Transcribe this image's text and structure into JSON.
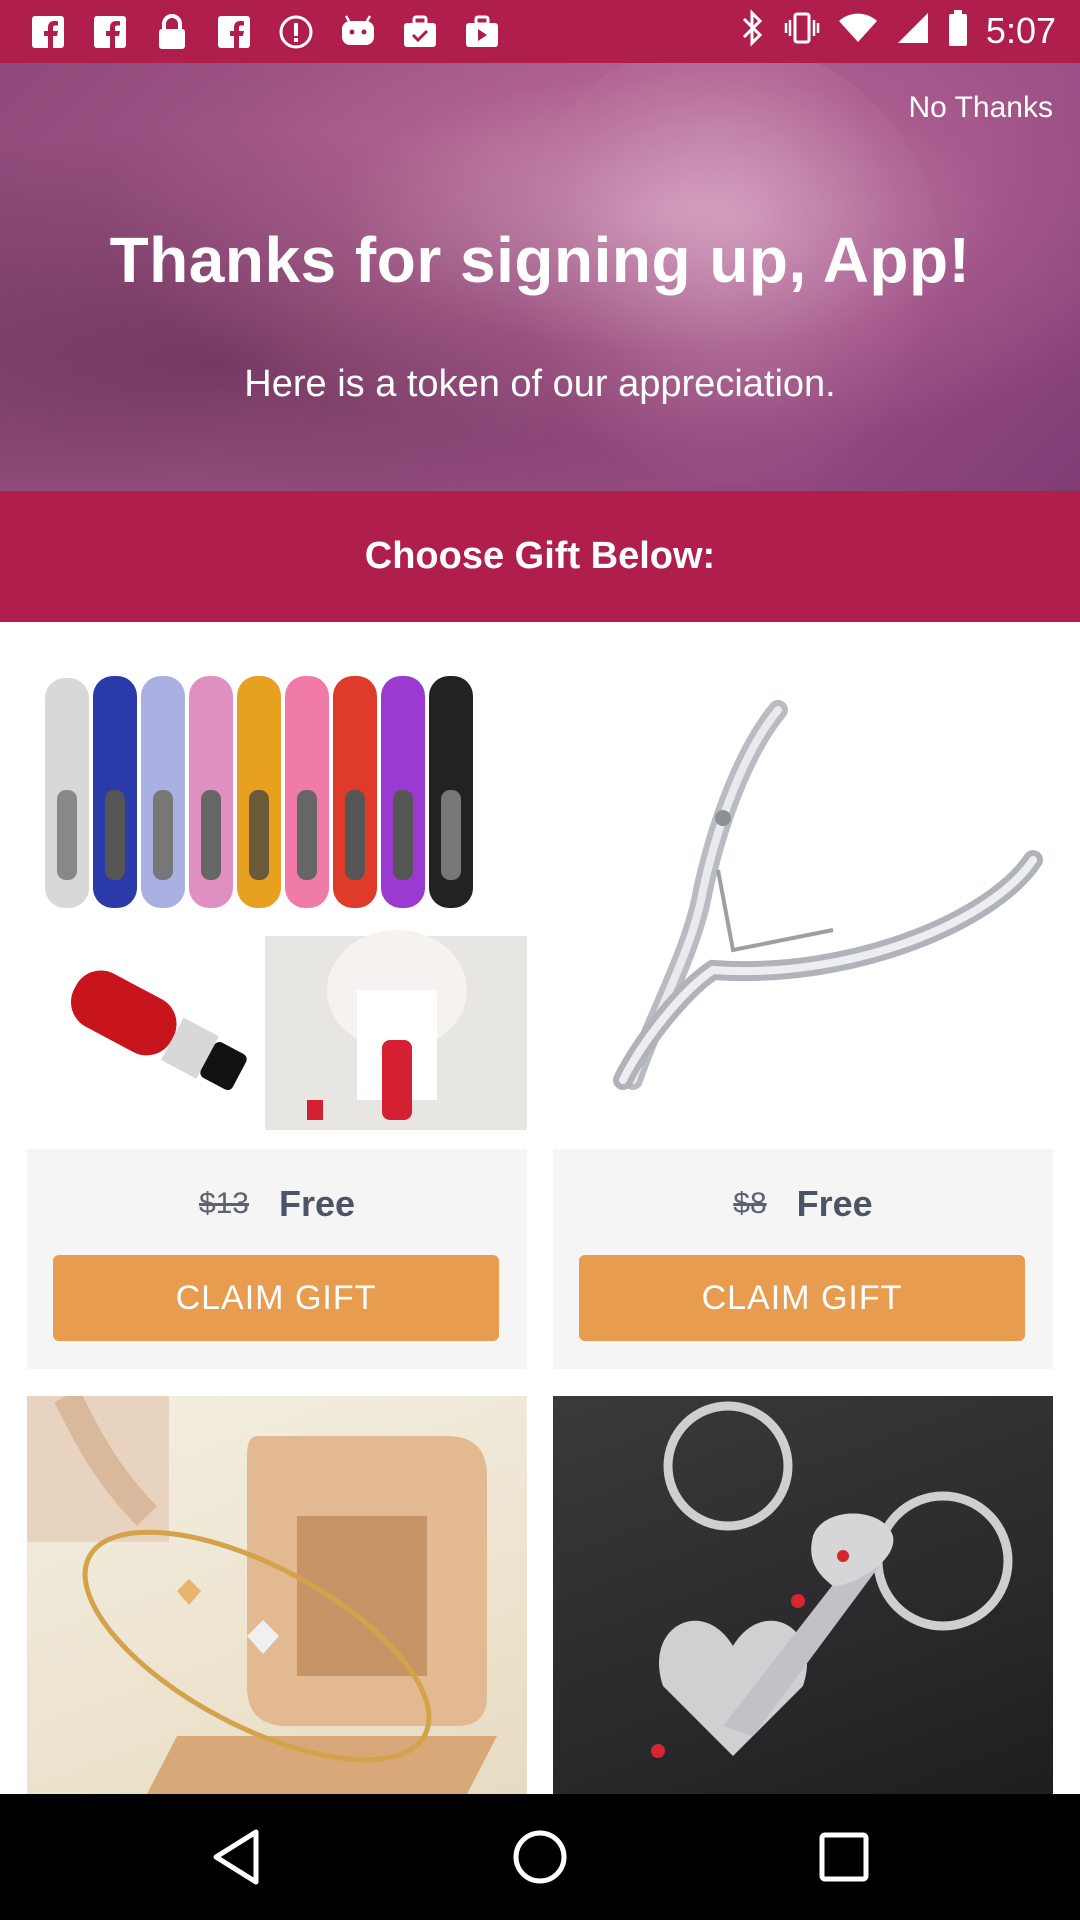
{
  "status_bar": {
    "time": "5:07",
    "icons": [
      "facebook-icon",
      "facebook-icon",
      "lock-icon",
      "facebook-icon",
      "circle-info-icon",
      "android-icon",
      "briefcase-check-icon",
      "briefcase-play-icon"
    ],
    "right_icons": [
      "bluetooth-icon",
      "vibrate-icon",
      "wifi-icon",
      "signal-icon",
      "battery-icon"
    ]
  },
  "hero": {
    "no_thanks": "No Thanks",
    "title": "Thanks for signing up, App!",
    "subtitle": "Here is a token of our appreciation."
  },
  "banner": {
    "label": "Choose Gift Below:"
  },
  "gifts": [
    {
      "image": "perfume-atomizer-bottles",
      "old_price": "$13",
      "new_price": "Free",
      "button": "CLAIM GIFT"
    },
    {
      "image": "cuticle-nipper",
      "old_price": "$8",
      "new_price": "Free",
      "button": "CLAIM GIFT"
    },
    {
      "image": "heart-bracelet-ring-box"
    },
    {
      "image": "heart-key-keychain"
    }
  ],
  "nav": [
    "back-icon",
    "home-icon",
    "recents-icon"
  ],
  "colors": {
    "brand": "#b01f4b",
    "button": "#e89c4f",
    "price_text": "#4c5566"
  }
}
